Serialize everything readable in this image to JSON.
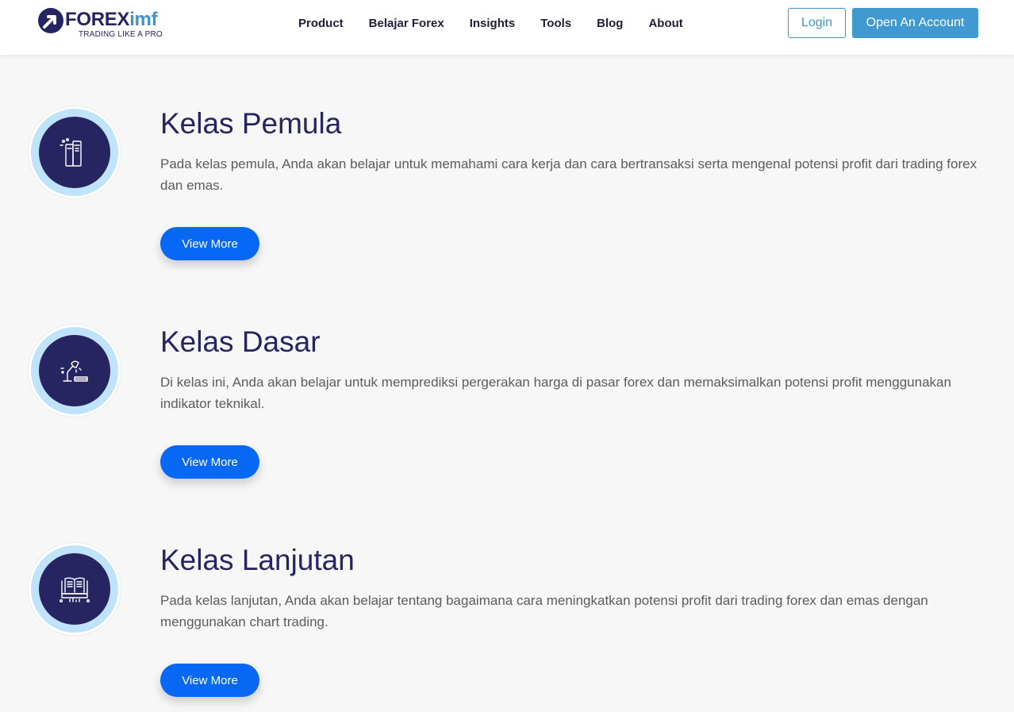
{
  "header": {
    "logo": {
      "word_main": "FOREX",
      "word_accent": "imf",
      "tagline": "TRADING LIKE A PRO"
    },
    "nav": [
      "Product",
      "Belajar Forex",
      "Insights",
      "Tools",
      "Blog",
      "About"
    ],
    "login_label": "Login",
    "open_account_label": "Open An Account"
  },
  "colors": {
    "brand_navy": "#262461",
    "brand_blue": "#3f94cc",
    "button_blue": "#0768f5",
    "ring_light_blue": "#bfe3fb"
  },
  "courses": [
    {
      "title": "Kelas Pemula",
      "description": "Pada kelas pemula, Anda akan belajar untuk memahami cara kerja dan cara bertransaksi serta mengenal potensi profit dari trading forex dan emas.",
      "button": "View More",
      "icon": "books-icon"
    },
    {
      "title": "Kelas Dasar",
      "description": "Di kelas ini, Anda akan belajar untuk memprediksi pergerakan harga di pasar forex dan memaksimalkan potensi profit menggunakan indikator teknikal.",
      "button": "View More",
      "icon": "desk-lamp-icon"
    },
    {
      "title": "Kelas Lanjutan",
      "description": "Pada kelas lanjutan, Anda akan belajar tentang bagaimana cara meningkatkan potensi profit dari trading forex dan emas dengan menggunakan chart trading.",
      "button": "View More",
      "icon": "open-book-icon"
    }
  ]
}
